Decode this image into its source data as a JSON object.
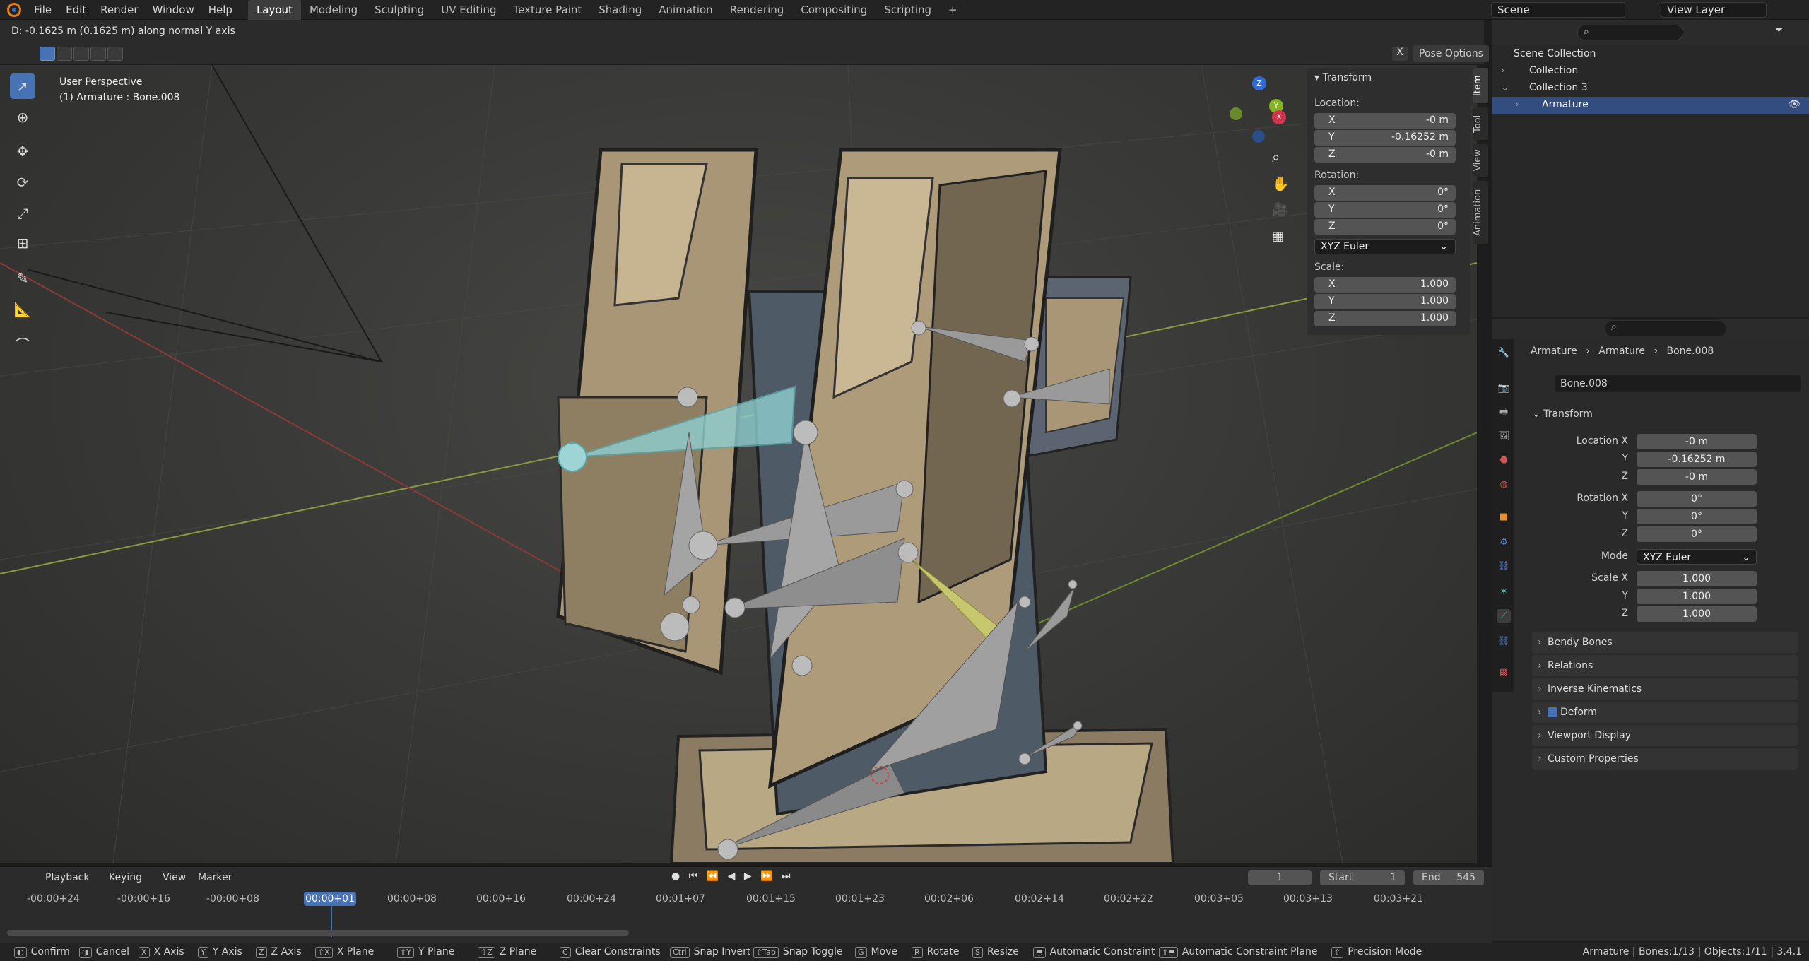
{
  "menu": [
    "File",
    "Edit",
    "Render",
    "Window",
    "Help"
  ],
  "workspaces": [
    "Layout",
    "Modeling",
    "Sculpting",
    "UV Editing",
    "Texture Paint",
    "Shading",
    "Animation",
    "Rendering",
    "Compositing",
    "Scripting",
    "+"
  ],
  "active_workspace": "Layout",
  "scene_name": "Scene",
  "view_layer": "View Layer",
  "header_status": "D: -0.1625 m (0.1625 m) along normal Y axis",
  "pose_options": "Pose Options",
  "viewport": {
    "title": "User Perspective",
    "subtitle": "(1) Armature : Bone.008"
  },
  "npanel": {
    "header": "Transform",
    "location_label": "Location:",
    "location": [
      {
        "ax": "X",
        "val": "-0 m"
      },
      {
        "ax": "Y",
        "val": "-0.16252 m"
      },
      {
        "ax": "Z",
        "val": "-0 m"
      }
    ],
    "rotation_label": "Rotation:",
    "rotation": [
      {
        "ax": "X",
        "val": "0°"
      },
      {
        "ax": "Y",
        "val": "0°"
      },
      {
        "ax": "Z",
        "val": "0°"
      }
    ],
    "rotation_mode": "XYZ Euler",
    "scale_label": "Scale:",
    "scale": [
      {
        "ax": "X",
        "val": "1.000"
      },
      {
        "ax": "Y",
        "val": "1.000"
      },
      {
        "ax": "Z",
        "val": "1.000"
      }
    ],
    "tabs": [
      "Item",
      "Tool",
      "View",
      "Animation"
    ]
  },
  "outliner": {
    "rows": [
      {
        "label": "Scene Collection"
      },
      {
        "label": "Collection"
      },
      {
        "label": "Collection 3"
      },
      {
        "label": "Armature"
      }
    ]
  },
  "props": {
    "breadcrumb": [
      "Armature",
      "Armature",
      "Bone.008"
    ],
    "bone_name": "Bone.008",
    "transform_header": "Transform",
    "location_x_label": "Location X",
    "y_label": "Y",
    "z_label": "Z",
    "rotation_x_label": "Rotation X",
    "mode_label": "Mode",
    "scale_x_label": "Scale X",
    "location": [
      "-0 m",
      "-0.16252 m",
      "-0 m"
    ],
    "rotation": [
      "0°",
      "0°",
      "0°"
    ],
    "mode": "XYZ Euler",
    "scale": [
      "1.000",
      "1.000",
      "1.000"
    ],
    "panels": [
      "Bendy Bones",
      "Relations",
      "Inverse Kinematics",
      "Deform",
      "Viewport Display",
      "Custom Properties"
    ]
  },
  "timeline": {
    "menus": [
      "Playback",
      "Keying",
      "View",
      "Marker"
    ],
    "current_frame": "1",
    "start_label": "Start",
    "start": "1",
    "end_label": "End",
    "end": "545",
    "ticks": [
      "-00:00+24",
      "-00:00+16",
      "-00:00+08",
      "00:00+08",
      "00:00+16",
      "00:00+24",
      "00:01+07",
      "00:01+15",
      "00:01+23",
      "00:02+06",
      "00:02+14",
      "00:02+22",
      "00:03+05",
      "00:03+13",
      "00:03+21"
    ],
    "playhead_label": "00:00+01"
  },
  "statusbar": {
    "items": [
      "Confirm",
      "Cancel",
      "X Axis",
      "Y Axis",
      "Z Axis",
      "X Plane",
      "Y Plane",
      "Z Plane",
      "Clear Constraints",
      "Snap Invert",
      "Snap Toggle",
      "Move",
      "Rotate",
      "Resize",
      "Automatic Constraint",
      "Automatic Constraint Plane",
      "Precision Mode"
    ],
    "right": "Armature | Bones:1/13 | Objects:1/11 | 3.4.1"
  },
  "colors": {
    "accent": "#4772b3",
    "selected_bone": "#7fbfc1",
    "active_bone": "#c8c870"
  }
}
